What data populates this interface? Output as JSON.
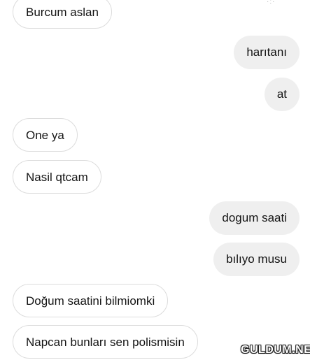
{
  "messages": [
    {
      "side": "incoming",
      "text": "Burcum aslan"
    },
    {
      "side": "outgoing",
      "text": "harıtanı"
    },
    {
      "side": "outgoing",
      "text": "at"
    },
    {
      "side": "incoming",
      "text": "One ya"
    },
    {
      "side": "incoming",
      "text": "Nasil qtcam"
    },
    {
      "side": "outgoing",
      "text": "dogum saati"
    },
    {
      "side": "outgoing",
      "text": "bılıyo musu"
    },
    {
      "side": "incoming",
      "text": "Doğum saatini bilmiomki"
    },
    {
      "side": "incoming",
      "text": "Napcan bunları sen polismisin"
    }
  ],
  "watermark": "GULDUM.NET",
  "colors": {
    "incoming_bg": "#ffffff",
    "incoming_border": "#dcdcdc",
    "outgoing_bg": "#efefef",
    "text": "#141414"
  }
}
